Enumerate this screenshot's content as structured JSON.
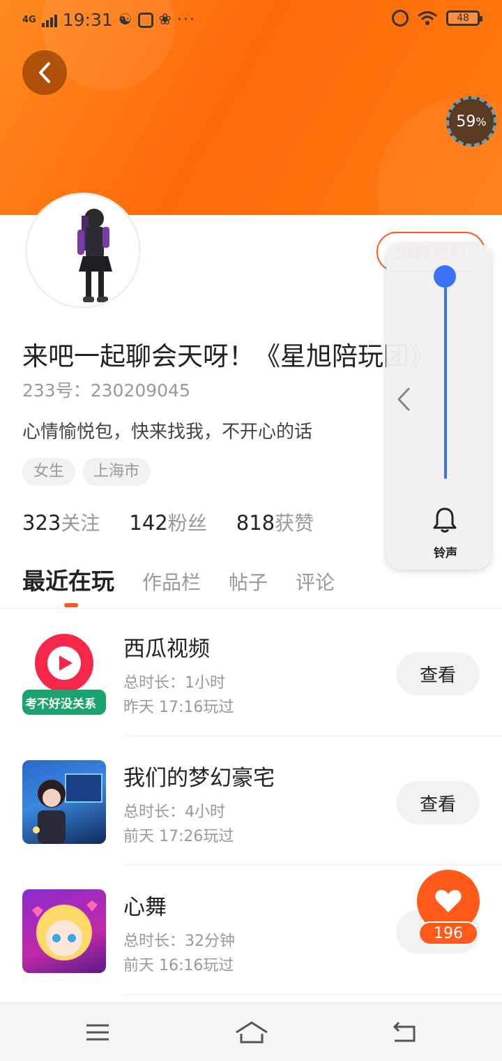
{
  "status_bar": {
    "network": "4G",
    "time": "19:31",
    "more": "···",
    "battery": "48"
  },
  "header": {
    "progress_value": "59",
    "progress_unit": "%"
  },
  "profile": {
    "edit_label": "编辑资料",
    "nickname": "来吧一起聊会天呀！《星旭陪玩团》",
    "uid": "233号：230209045",
    "bio": "心情愉悦包，快来找我，不开心的话",
    "tags": [
      "女生",
      "上海市"
    ]
  },
  "stats": {
    "following_count": "323",
    "following_label": "关注",
    "followers_count": "142",
    "followers_label": "粉丝",
    "likes_count": "818",
    "likes_label": "获赞"
  },
  "tabs": [
    {
      "label": "最近在玩",
      "active": true
    },
    {
      "label": "作品栏",
      "active": false
    },
    {
      "label": "帖子",
      "active": false
    },
    {
      "label": "评论",
      "active": false
    }
  ],
  "games": [
    {
      "title": "西瓜视频",
      "duration": "总时长：1小时",
      "last_played": "昨天 17:16玩过",
      "button": "查看",
      "icon_caption": "考不好没关系"
    },
    {
      "title": "我们的梦幻豪宅",
      "duration": "总时长：4小时",
      "last_played": "前天 17:26玩过",
      "button": "查看"
    },
    {
      "title": "心舞",
      "duration": "总时长：32分钟",
      "last_played": "前天 16:16玩过",
      "button": "查看"
    }
  ],
  "volume": {
    "label": "铃声",
    "level": 0.98,
    "accent": "#3b73f6"
  },
  "like_fab": {
    "count": "196"
  },
  "colors": {
    "brand": "#ff5a1a",
    "banner": "#ff7a10"
  }
}
